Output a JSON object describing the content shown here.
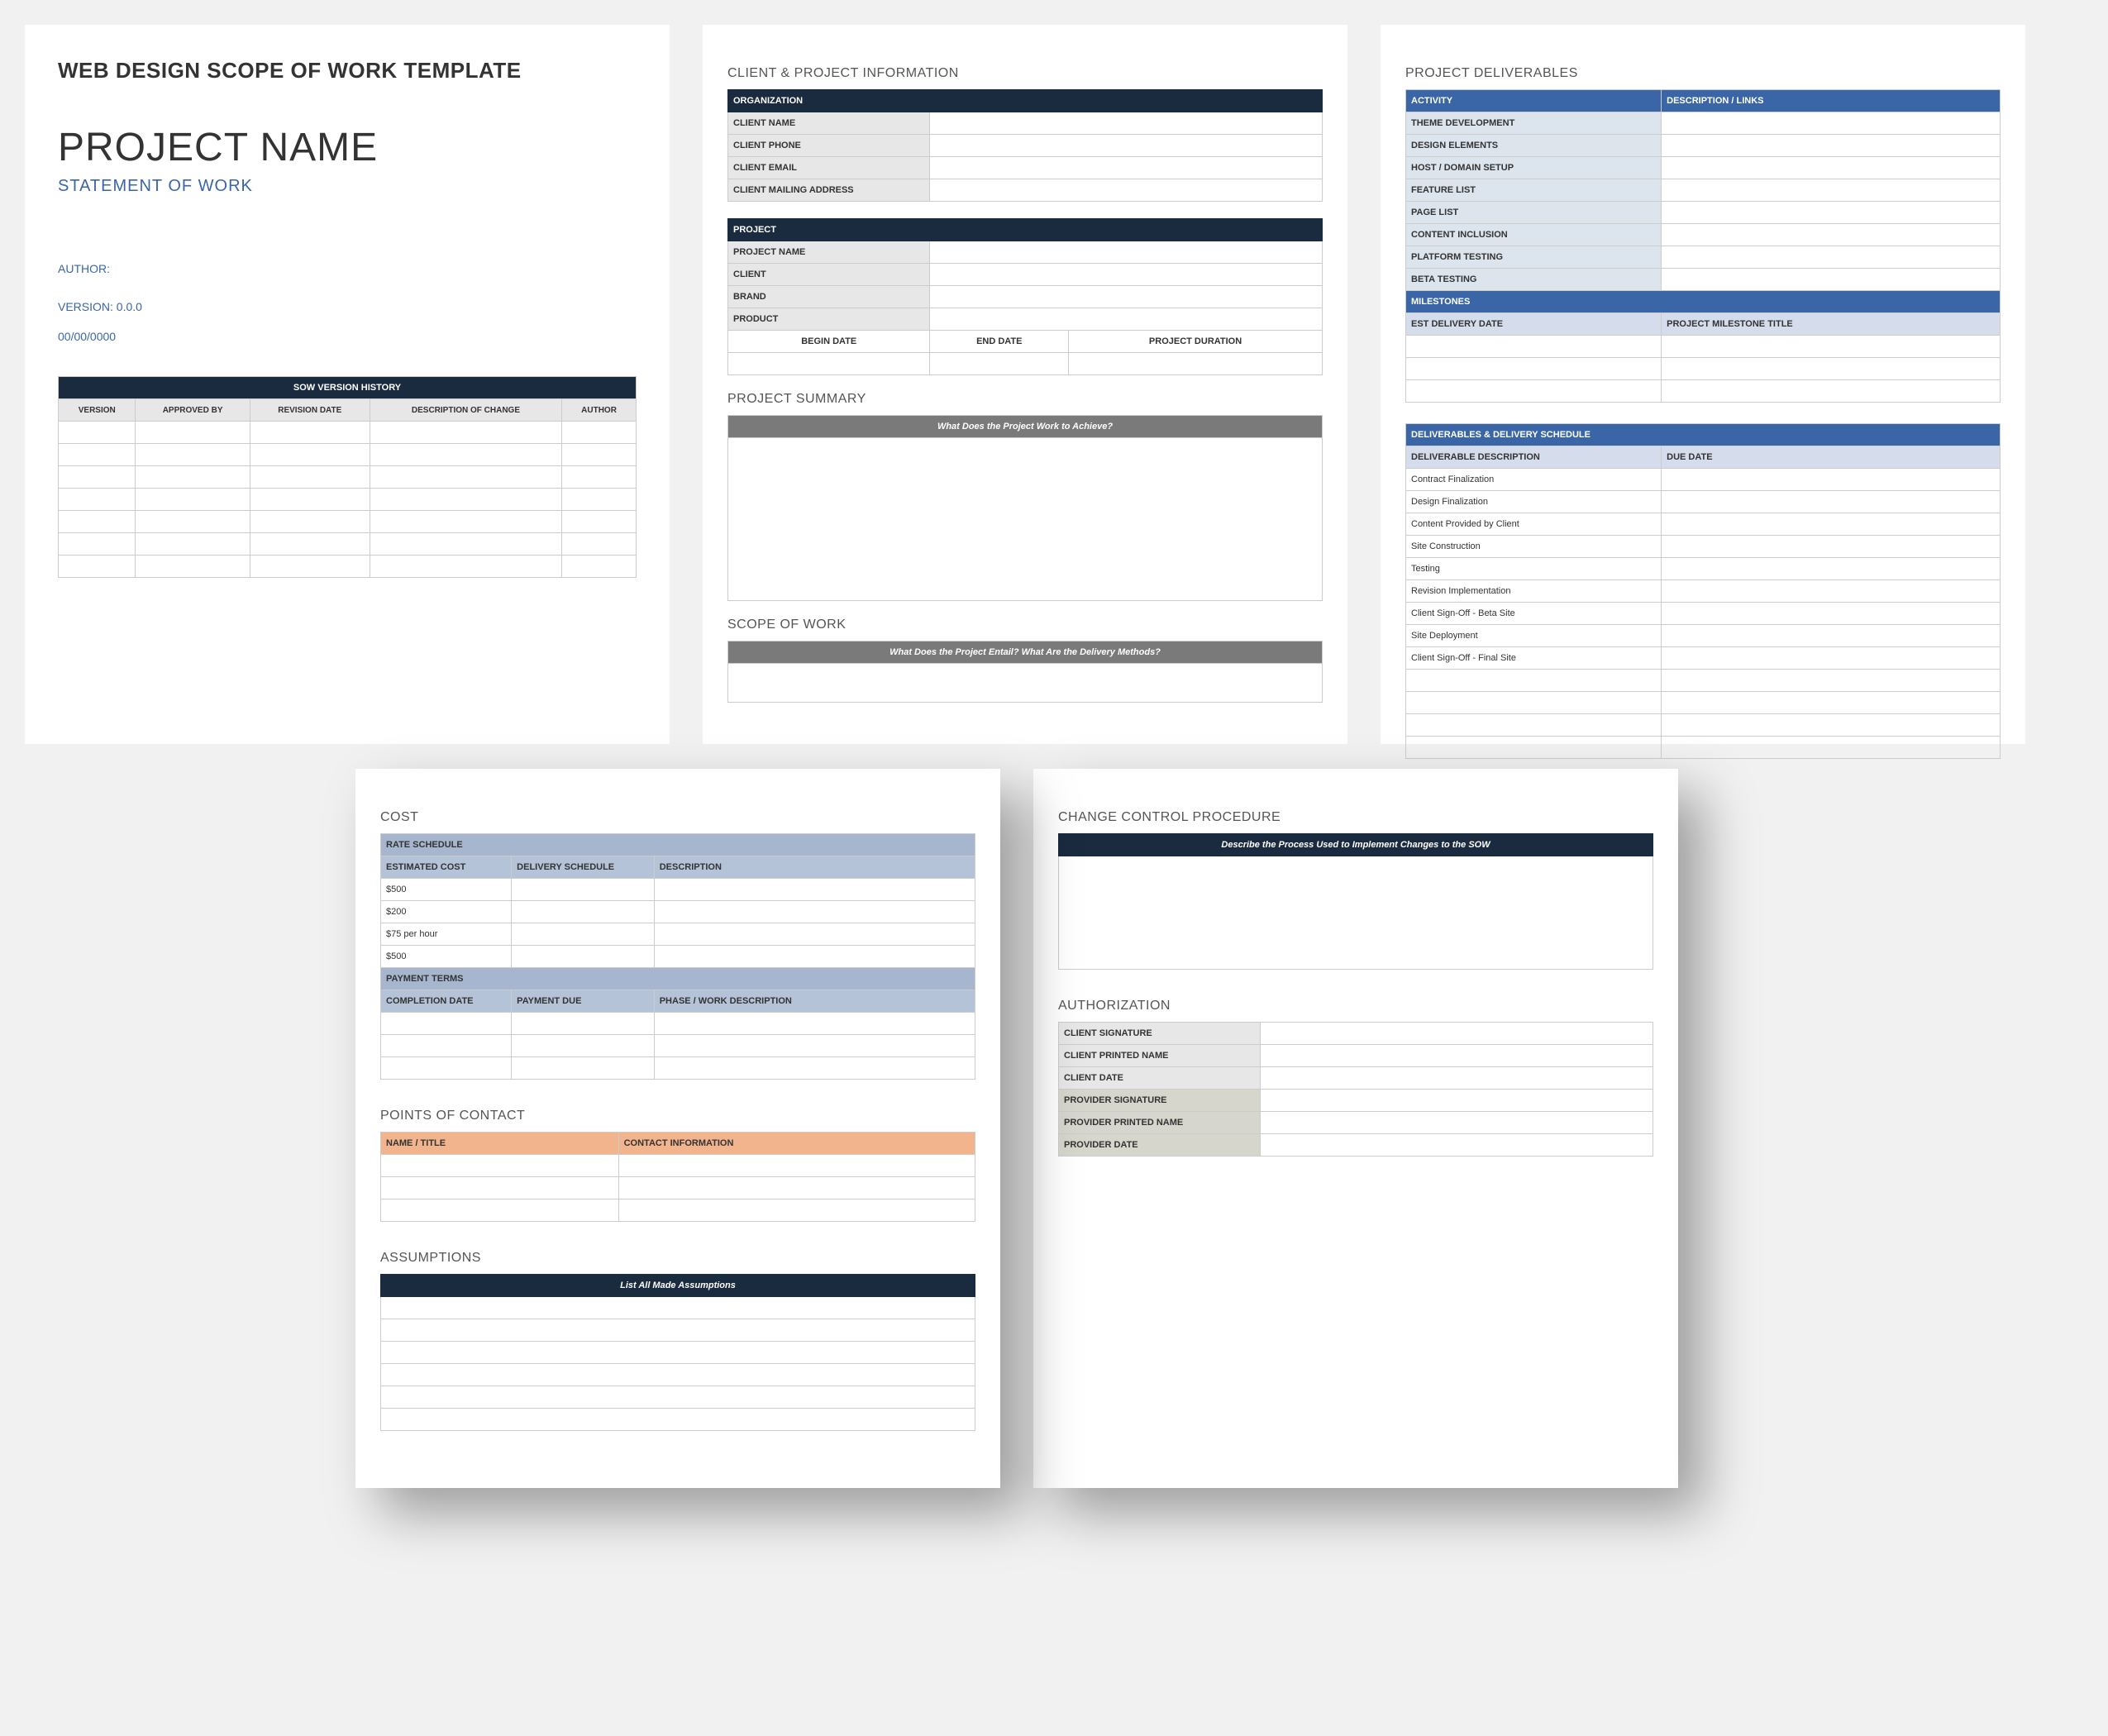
{
  "cover": {
    "template_title": "WEB DESIGN SCOPE OF WORK TEMPLATE",
    "project_name": "PROJECT NAME",
    "subtitle": "STATEMENT OF WORK",
    "author_label": "AUTHOR:",
    "version_label": "VERSION: 0.0.0",
    "date": "00/00/0000",
    "history": {
      "title": "SOW VERSION HISTORY",
      "cols": [
        "VERSION",
        "APPROVED BY",
        "REVISION DATE",
        "DESCRIPTION OF CHANGE",
        "AUTHOR"
      ]
    }
  },
  "info": {
    "section": "CLIENT & PROJECT INFORMATION",
    "org": "ORGANIZATION",
    "org_rows": [
      "CLIENT NAME",
      "CLIENT  PHONE",
      "CLIENT EMAIL",
      "CLIENT MAILING ADDRESS"
    ],
    "proj": "PROJECT",
    "proj_rows": [
      "PROJECT NAME",
      "CLIENT",
      "BRAND",
      "PRODUCT"
    ],
    "dates": [
      "BEGIN DATE",
      "END DATE",
      "PROJECT DURATION"
    ],
    "summary": "PROJECT SUMMARY",
    "summary_q": "What Does the Project Work to Achieve?",
    "scope": "SCOPE OF WORK",
    "scope_q": "What Does the Project Entail? What Are the Delivery Methods?"
  },
  "deliv": {
    "section": "PROJECT DELIVERABLES",
    "cols": [
      "ACTIVITY",
      "DESCRIPTION / LINKS"
    ],
    "activities": [
      "THEME DEVELOPMENT",
      "DESIGN ELEMENTS",
      "HOST / DOMAIN SETUP",
      "FEATURE LIST",
      "PAGE LIST",
      "CONTENT INCLUSION",
      "PLATFORM TESTING",
      "BETA TESTING"
    ],
    "milestones": "MILESTONES",
    "mcols": [
      "EST DELIVERY DATE",
      "PROJECT MILESTONE TITLE"
    ],
    "sched": "DELIVERABLES & DELIVERY SCHEDULE",
    "scols": [
      "DELIVERABLE DESCRIPTION",
      "DUE DATE"
    ],
    "items": [
      "Contract Finalization",
      "Design Finalization",
      "Content Provided by Client",
      "Site Construction",
      "Testing",
      "Revision Implementation",
      "Client Sign-Off - Beta Site",
      "Site Deployment",
      "Client Sign-Off - Final Site"
    ]
  },
  "cost": {
    "section": "COST",
    "rate": "RATE SCHEDULE",
    "rcols": [
      "ESTIMATED COST",
      "DELIVERY SCHEDULE",
      "DESCRIPTION"
    ],
    "rates": [
      "$500",
      "$200",
      "$75 per hour",
      "$500"
    ],
    "pay": "PAYMENT TERMS",
    "pcols": [
      "COMPLETION DATE",
      "PAYMENT DUE",
      "PHASE / WORK DESCRIPTION"
    ],
    "contacts": "POINTS OF CONTACT",
    "ccols": [
      "NAME / TITLE",
      "CONTACT INFORMATION"
    ],
    "assume": "ASSUMPTIONS",
    "assume_q": "List All Made Assumptions"
  },
  "auth": {
    "change": "CHANGE CONTROL PROCEDURE",
    "change_q": "Describe the Process Used to Implement Changes to the SOW",
    "section": "AUTHORIZATION",
    "client": [
      "CLIENT SIGNATURE",
      "CLIENT PRINTED NAME",
      "CLIENT DATE"
    ],
    "prov": [
      "PROVIDER SIGNATURE",
      "PROVIDER PRINTED NAME",
      "PROVIDER DATE"
    ]
  }
}
